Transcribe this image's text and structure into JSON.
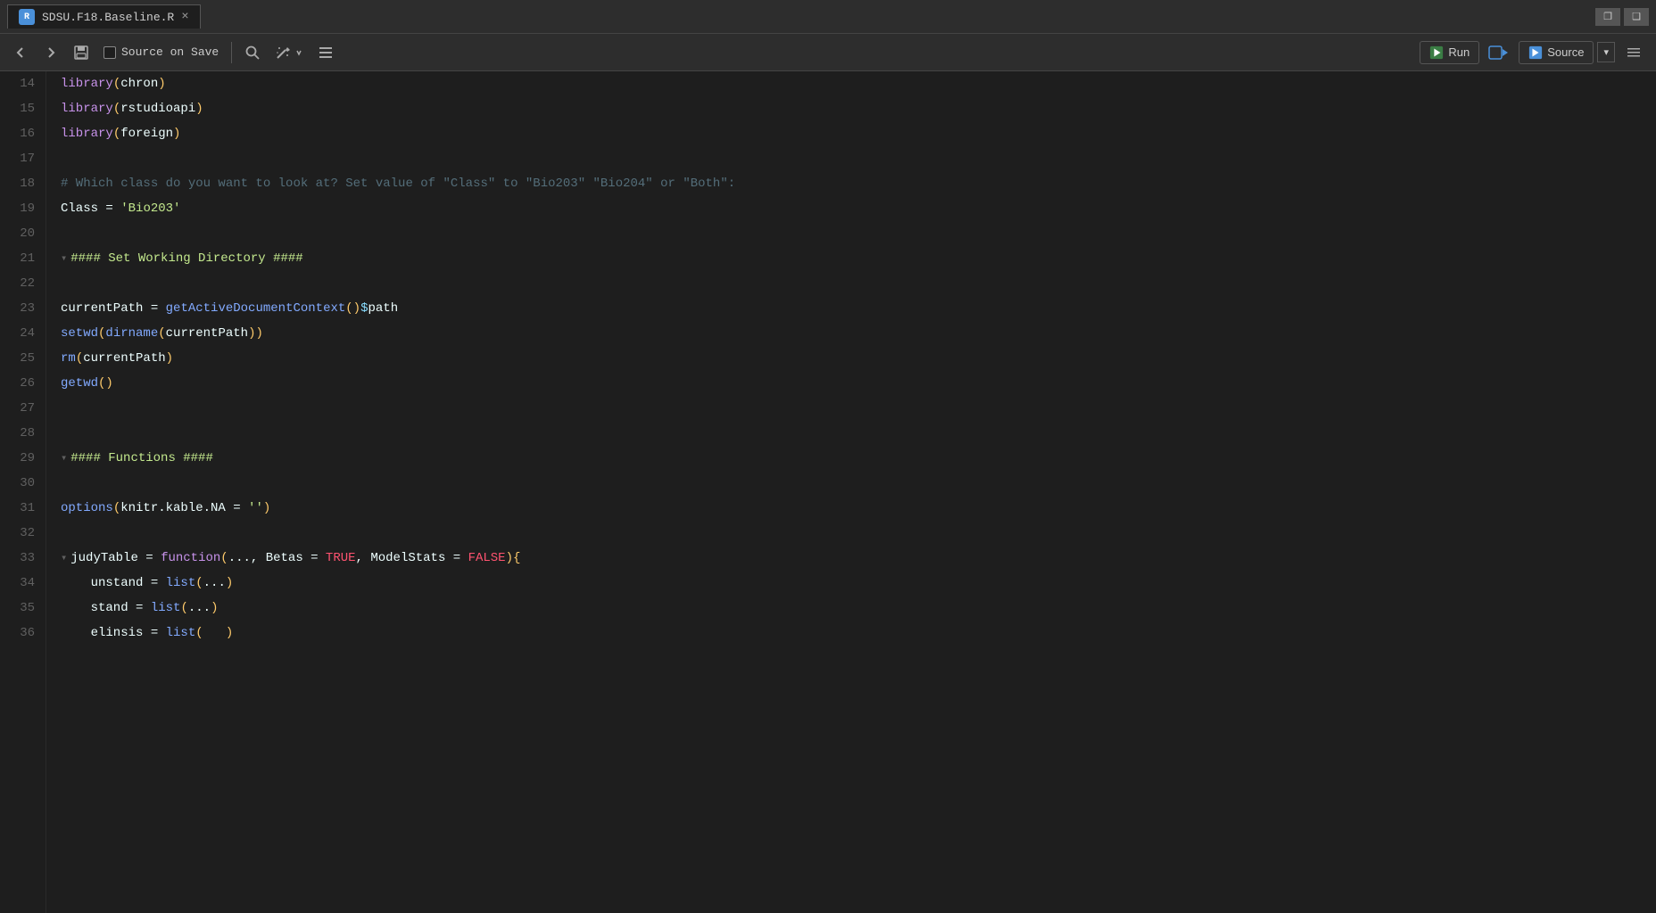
{
  "titleBar": {
    "tab": {
      "icon": "R",
      "label": "SDSU.F18.Baseline.R",
      "close": "×"
    },
    "windowControls": {
      "restore": "🗗",
      "maximize": "🗖"
    }
  },
  "toolbar": {
    "back_label": "←",
    "forward_label": "→",
    "save_label": "💾",
    "source_on_save_label": "Source on Save",
    "search_label": "🔍",
    "magic_label": "✨",
    "list_label": "☰",
    "run_label": "Run",
    "goto_label": "→",
    "source_label": "Source",
    "source_dropdown": "▾",
    "hamburger_label": "≡"
  },
  "code": {
    "lines": [
      {
        "num": 14,
        "content": "library(chron)",
        "tokens": [
          {
            "t": "kw",
            "v": "library"
          },
          {
            "t": "paren",
            "v": "("
          },
          {
            "t": "plain",
            "v": "chron"
          },
          {
            "t": "paren",
            "v": ")"
          }
        ]
      },
      {
        "num": 15,
        "content": "library(rstudioapi)",
        "tokens": [
          {
            "t": "kw",
            "v": "library"
          },
          {
            "t": "paren",
            "v": "("
          },
          {
            "t": "plain",
            "v": "rstudioapi"
          },
          {
            "t": "paren",
            "v": ")"
          }
        ]
      },
      {
        "num": 16,
        "content": "library(foreign)",
        "tokens": [
          {
            "t": "kw",
            "v": "library"
          },
          {
            "t": "paren",
            "v": "("
          },
          {
            "t": "plain",
            "v": "foreign"
          },
          {
            "t": "paren",
            "v": ")"
          }
        ]
      },
      {
        "num": 17,
        "content": "",
        "tokens": []
      },
      {
        "num": 18,
        "content": "# Which class do you want to look at? Set value of \"Class\" to \"Bio203\" \"Bio204\" or \"Both\":",
        "tokens": [
          {
            "t": "cmt",
            "v": "# Which class do you want to look at? Set value of \"Class\" to \"Bio203\" \"Bio204\" or \"Both\":"
          }
        ]
      },
      {
        "num": 19,
        "content": "Class = 'Bio203'",
        "tokens": [
          {
            "t": "plain",
            "v": "Class"
          },
          {
            "t": "plain",
            "v": " = "
          },
          {
            "t": "str",
            "v": "'Bio203'"
          }
        ]
      },
      {
        "num": 20,
        "content": "",
        "tokens": []
      },
      {
        "num": 21,
        "content": "#### Set Working Directory ####",
        "fold": true,
        "tokens": [
          {
            "t": "section-cmt",
            "v": "#### Set Working Directory ####"
          }
        ]
      },
      {
        "num": 22,
        "content": "",
        "tokens": []
      },
      {
        "num": 23,
        "content": "currentPath = getActiveDocumentContext()$path",
        "tokens": [
          {
            "t": "plain",
            "v": "currentPath"
          },
          {
            "t": "plain",
            "v": " = "
          },
          {
            "t": "fn",
            "v": "getActiveDocumentContext"
          },
          {
            "t": "paren",
            "v": "()"
          },
          {
            "t": "op",
            "v": "$"
          },
          {
            "t": "plain",
            "v": "path"
          }
        ]
      },
      {
        "num": 24,
        "content": "setwd(dirname(currentPath))",
        "tokens": [
          {
            "t": "fn",
            "v": "setwd"
          },
          {
            "t": "paren",
            "v": "("
          },
          {
            "t": "fn",
            "v": "dirname"
          },
          {
            "t": "paren",
            "v": "("
          },
          {
            "t": "plain",
            "v": "currentPath"
          },
          {
            "t": "paren",
            "v": "))"
          }
        ]
      },
      {
        "num": 25,
        "content": "rm(currentPath)",
        "tokens": [
          {
            "t": "fn",
            "v": "rm"
          },
          {
            "t": "paren",
            "v": "("
          },
          {
            "t": "plain",
            "v": "currentPath"
          },
          {
            "t": "paren",
            "v": ")"
          }
        ]
      },
      {
        "num": 26,
        "content": "getwd()",
        "tokens": [
          {
            "t": "fn",
            "v": "getwd"
          },
          {
            "t": "paren",
            "v": "()"
          }
        ]
      },
      {
        "num": 27,
        "content": "",
        "tokens": []
      },
      {
        "num": 28,
        "content": "",
        "tokens": []
      },
      {
        "num": 29,
        "content": "#### Functions ####",
        "fold": true,
        "tokens": [
          {
            "t": "section-cmt",
            "v": "#### Functions ####"
          }
        ]
      },
      {
        "num": 30,
        "content": "",
        "tokens": []
      },
      {
        "num": 31,
        "content": "options(knitr.kable.NA = '')",
        "tokens": [
          {
            "t": "fn",
            "v": "options"
          },
          {
            "t": "paren",
            "v": "("
          },
          {
            "t": "plain",
            "v": "knitr.kable.NA = "
          },
          {
            "t": "str",
            "v": "''"
          },
          {
            "t": "paren",
            "v": ")"
          }
        ]
      },
      {
        "num": 32,
        "content": "",
        "tokens": []
      },
      {
        "num": 33,
        "content": "judyTable = function(..., Betas = TRUE, ModelStats = FALSE){",
        "fold": true,
        "tokens": [
          {
            "t": "plain",
            "v": "judyTable"
          },
          {
            "t": "plain",
            "v": " = "
          },
          {
            "t": "kw",
            "v": "function"
          },
          {
            "t": "paren",
            "v": "("
          },
          {
            "t": "plain",
            "v": "..., Betas = "
          },
          {
            "t": "bool",
            "v": "TRUE"
          },
          {
            "t": "plain",
            "v": ", ModelStats = "
          },
          {
            "t": "bool",
            "v": "FALSE"
          },
          {
            "t": "paren",
            "v": ")"
          },
          {
            "t": "paren",
            "v": "{"
          }
        ]
      },
      {
        "num": 34,
        "content": "    unstand = list(...)",
        "tokens": [
          {
            "t": "plain",
            "v": "    unstand = "
          },
          {
            "t": "fn",
            "v": "list"
          },
          {
            "t": "paren",
            "v": "("
          },
          {
            "t": "plain",
            "v": "..."
          },
          {
            "t": "paren",
            "v": ")"
          }
        ]
      },
      {
        "num": 35,
        "content": "    stand = list(...)",
        "tokens": [
          {
            "t": "plain",
            "v": "    stand = "
          },
          {
            "t": "fn",
            "v": "list"
          },
          {
            "t": "paren",
            "v": "("
          },
          {
            "t": "plain",
            "v": "..."
          },
          {
            "t": "paren",
            "v": ")"
          }
        ]
      },
      {
        "num": 36,
        "content": "    elinsis = list(   )",
        "tokens": [
          {
            "t": "plain",
            "v": "    elinsis = "
          },
          {
            "t": "fn",
            "v": "list"
          },
          {
            "t": "paren",
            "v": "(   )"
          }
        ]
      }
    ]
  }
}
